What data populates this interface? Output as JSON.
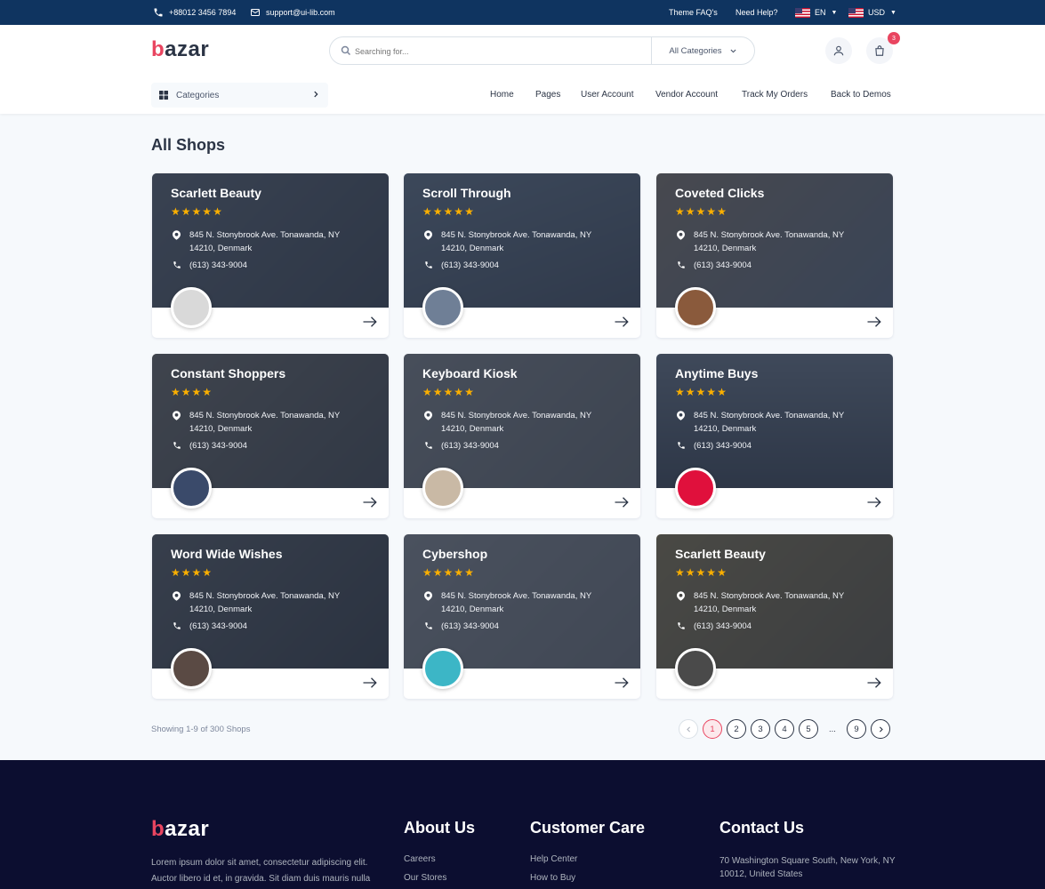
{
  "topbar": {
    "phone": "+88012 3456 7894",
    "email": "support@ui-lib.com",
    "links": [
      "Theme FAQ's",
      "Need Help?"
    ],
    "language": "EN",
    "currency": "USD"
  },
  "header": {
    "logo_b": "b",
    "logo_rest": "azar",
    "search_placeholder": "Searching for...",
    "search_category": "All Categories",
    "cart_count": "3",
    "categories_label": "Categories",
    "nav": [
      "Home",
      "Pages",
      "User Account",
      "Vendor Account",
      "Track My Orders",
      "Back to Demos"
    ]
  },
  "main": {
    "title": "All Shops",
    "shops": [
      {
        "name": "Scarlett Beauty",
        "rating": 5,
        "address": "845 N. Stonybrook Ave. Tonawanda, NY 14210, Denmark",
        "phone": "(613) 343-9004",
        "avatar_icon": "bicycle-icon"
      },
      {
        "name": "Scroll Through",
        "rating": 5,
        "address": "845 N. Stonybrook Ave. Tonawanda, NY 14210, Denmark",
        "phone": "(613) 343-9004",
        "avatar_icon": "road-icon"
      },
      {
        "name": "Coveted Clicks",
        "rating": 5,
        "address": "845 N. Stonybrook Ave. Tonawanda, NY 14210, Denmark",
        "phone": "(613) 343-9004",
        "avatar_icon": "bottles-icon"
      },
      {
        "name": "Constant Shoppers",
        "rating": 4,
        "address": "845 N. Stonybrook Ave. Tonawanda, NY 14210, Denmark",
        "phone": "(613) 343-9004",
        "avatar_icon": "person-icon"
      },
      {
        "name": "Keyboard Kiosk",
        "rating": 5,
        "address": "845 N. Stonybrook Ave. Tonawanda, NY 14210, Denmark",
        "phone": "(613) 343-9004",
        "avatar_icon": "jars-icon"
      },
      {
        "name": "Anytime Buys",
        "rating": 5,
        "address": "845 N. Stonybrook Ave. Tonawanda, NY 14210, Denmark",
        "phone": "(613) 343-9004",
        "avatar_icon": "gamepad-icon"
      },
      {
        "name": "Word Wide Wishes",
        "rating": 4,
        "address": "845 N. Stonybrook Ave. Tonawanda, NY 14210, Denmark",
        "phone": "(613) 343-9004",
        "avatar_icon": "watch-icon"
      },
      {
        "name": "Cybershop",
        "rating": 5,
        "address": "845 N. Stonybrook Ave. Tonawanda, NY 14210, Denmark",
        "phone": "(613) 343-9004",
        "avatar_icon": "bottle-icon"
      },
      {
        "name": "Scarlett Beauty",
        "rating": 5,
        "address": "845 N. Stonybrook Ave. Tonawanda, NY 14210, Denmark",
        "phone": "(613) 343-9004",
        "avatar_icon": "hand-icon"
      }
    ],
    "showing": "Showing 1-9 of 300 Shops",
    "pages": [
      "1",
      "2",
      "3",
      "4",
      "5",
      "...",
      "9"
    ],
    "current_page": "1"
  },
  "footer": {
    "logo_b": "b",
    "logo_rest": "azar",
    "description": "Lorem ipsum dolor sit amet, consectetur adipiscing elit. Auctor libero id et, in gravida. Sit diam duis mauris nulla",
    "about_title": "About Us",
    "about_links": [
      "Careers",
      "Our Stores"
    ],
    "care_title": "Customer Care",
    "care_links": [
      "Help Center",
      "How to Buy"
    ],
    "contact_title": "Contact Us",
    "contact_address": "70 Washington Square South, New York, NY 10012, United States"
  },
  "colors": {
    "topbar": "#0f3460",
    "accent": "#e94560",
    "star": "#faaf00",
    "footer": "#0c0e30"
  }
}
